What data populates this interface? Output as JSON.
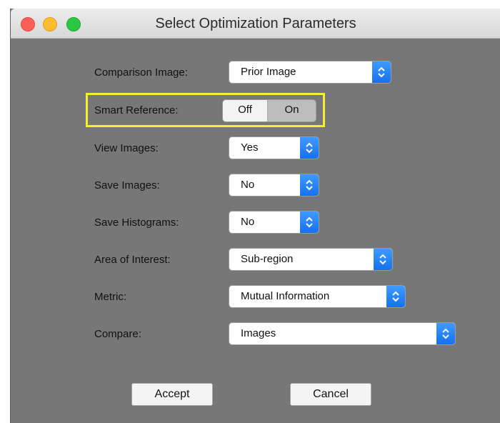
{
  "window": {
    "title": "Select Optimization Parameters"
  },
  "icons": {
    "close": "close-window-icon",
    "minimize": "minimize-window-icon",
    "zoom": "zoom-window-icon",
    "chevron": "updown-chevron-icon"
  },
  "colors": {
    "accent": "#1670ef",
    "highlight": "#f2f02f",
    "close": "#fc5f57",
    "minimize": "#fdbc2e",
    "zoom": "#28c840"
  },
  "fields": {
    "comparison_image": {
      "label": "Comparison Image:",
      "value": "Prior Image"
    },
    "smart_reference": {
      "label": "Smart Reference:",
      "options": [
        "Off",
        "On"
      ],
      "selected": "On"
    },
    "view_images": {
      "label": "View Images:",
      "value": "Yes"
    },
    "save_images": {
      "label": "Save Images:",
      "value": "No"
    },
    "save_histograms": {
      "label": "Save Histograms:",
      "value": "No"
    },
    "area_of_interest": {
      "label": "Area of Interest:",
      "value": "Sub-region"
    },
    "metric": {
      "label": "Metric:",
      "value": "Mutual Information"
    },
    "compare": {
      "label": "Compare:",
      "value": "Images"
    }
  },
  "buttons": {
    "accept": "Accept",
    "cancel": "Cancel"
  }
}
